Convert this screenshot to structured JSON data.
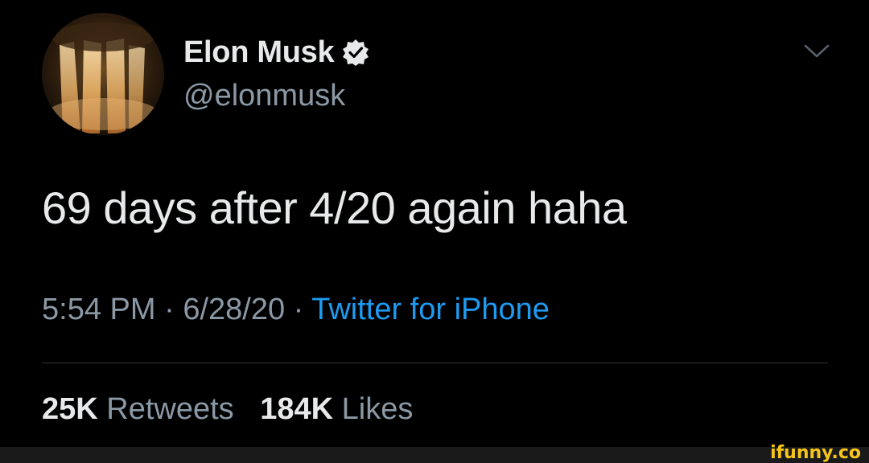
{
  "author": {
    "name": "Elon Musk",
    "handle": "@elonmusk",
    "verified": true,
    "avatar": "avatar-image"
  },
  "tweet": {
    "text": "69 days after 4/20 again haha"
  },
  "meta": {
    "time": "5:54 PM",
    "separator": " · ",
    "date": "6/28/20",
    "source": "Twitter for iPhone"
  },
  "stats": {
    "retweets_count": "25K",
    "retweets_label": "Retweets",
    "likes_count": "184K",
    "likes_label": "Likes"
  },
  "icons": {
    "verified": "verified-badge-icon",
    "menu": "chevron-down-icon"
  },
  "watermark": "ifunny.co",
  "colors": {
    "background": "#000000",
    "primary_text": "#e7e9ea",
    "secondary_text": "#8b98a5",
    "link": "#1d9bf0",
    "divider": "#2f3336",
    "watermark": "#f5c518"
  }
}
